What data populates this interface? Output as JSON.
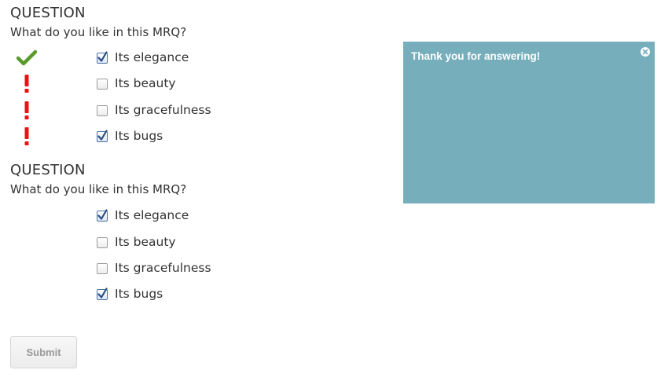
{
  "questions": [
    {
      "title": "QUESTION",
      "text": "What do you like in this MRQ?",
      "choices": [
        {
          "label": "Its elegance",
          "checked": true,
          "result": "correct"
        },
        {
          "label": "Its beauty",
          "checked": false,
          "result": "incorrect"
        },
        {
          "label": "Its gracefulness",
          "checked": false,
          "result": "incorrect"
        },
        {
          "label": "Its bugs",
          "checked": true,
          "result": "incorrect"
        }
      ]
    },
    {
      "title": "QUESTION",
      "text": "What do you like in this MRQ?",
      "choices": [
        {
          "label": "Its elegance",
          "checked": true
        },
        {
          "label": "Its beauty",
          "checked": false
        },
        {
          "label": "Its gracefulness",
          "checked": false
        },
        {
          "label": "Its bugs",
          "checked": true
        }
      ]
    }
  ],
  "feedback": {
    "message": "Thank you for answering!",
    "background_color": "#76aebc",
    "close_icon": "close-circle-icon"
  },
  "submit": {
    "label": "Submit",
    "disabled": true
  },
  "colors": {
    "correct": "#5a9a2a",
    "incorrect": "#ee1111",
    "checkmark": "#2a4f85"
  }
}
